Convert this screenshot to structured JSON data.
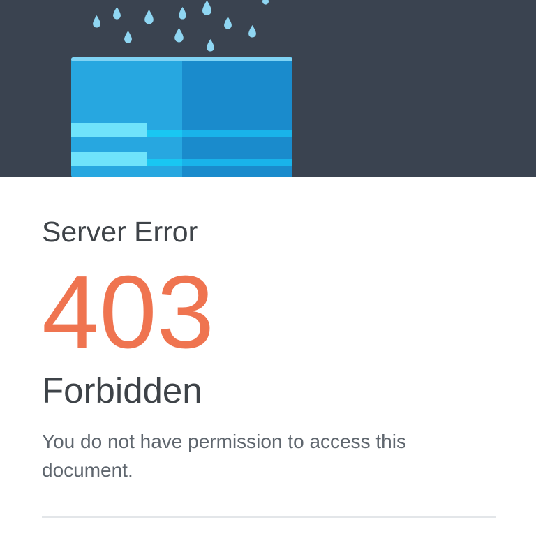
{
  "error": {
    "heading": "Server Error",
    "code": "403",
    "title": "Forbidden",
    "message": "You do not have permission to access this document."
  },
  "illustration": {
    "name": "raining-cloud-server",
    "icons": [
      "raindrop-icon",
      "server-icon"
    ]
  },
  "colors": {
    "hero_background": "#3a4350",
    "server_light": "#27a7e0",
    "server_dark": "#1a8bcc",
    "raindrop": "#8fd6f2",
    "code": "#ef7450",
    "heading_text": "#3e4348",
    "body_text": "#5f666e",
    "divider": "#e3e6e9"
  }
}
